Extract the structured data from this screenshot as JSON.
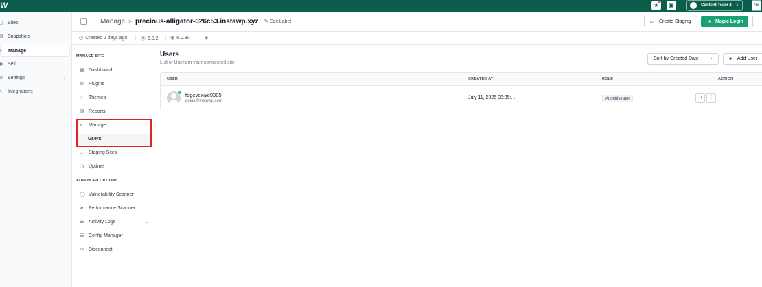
{
  "topbar": {
    "logo": "W",
    "notif_icon": "megaphone-icon",
    "monitor_icon": "monitor-icon",
    "team_name": "Content Team 2",
    "user_initials": "NS"
  },
  "nav": {
    "items": [
      {
        "label": "Sites",
        "icon": "sites-icon"
      },
      {
        "label": "Snapshots",
        "icon": "snapshots-icon"
      },
      {
        "label": "Manage",
        "icon": "manage-icon"
      },
      {
        "label": "Sell",
        "icon": "sell-icon"
      },
      {
        "label": "Settings",
        "icon": "settings-icon"
      },
      {
        "label": "Integrations",
        "icon": "integrations-icon"
      }
    ]
  },
  "header": {
    "breadcrumb_root": "Manage",
    "breadcrumb_sep": ">",
    "site_name": "precious-alligator-026c53.instawp.xyz",
    "edit_label": "Edit Label",
    "create_staging": "Create Staging",
    "magic_login": "Magic Login",
    "more": "···"
  },
  "meta": {
    "created": "Created 2 days ago",
    "wp_version": "6.8.2",
    "php_version": "8.0.30"
  },
  "subnav": {
    "manage_site_title": "MANAGE SITE",
    "advanced_title": "ADVANCED OPTIONS",
    "items": {
      "dashboard": "Dashboard",
      "plugins": "Plugins",
      "themes": "Themes",
      "reports": "Reports",
      "manage": "Manage",
      "users": "Users",
      "staging": "Staging Sites",
      "uptime": "Uptime",
      "vuln": "Vulnerability Scanner",
      "perf": "Performance Scanner",
      "activity": "Activity Logs",
      "config": "Config Manager",
      "disconnect": "Disconnect"
    }
  },
  "content": {
    "title": "Users",
    "subtitle": "List of Users in your connected site",
    "sort_label": "Sort by Created Date",
    "add_user": "Add User",
    "columns": {
      "user": "USER",
      "created": "CREATED AT",
      "role": "ROLE",
      "action": "ACTION"
    },
    "rows": [
      {
        "username": "fogevexiyo9005",
        "email": "palak@instawp.com",
        "created_at": "July 11, 2025 08:35:...",
        "role": "Administrator"
      }
    ]
  }
}
